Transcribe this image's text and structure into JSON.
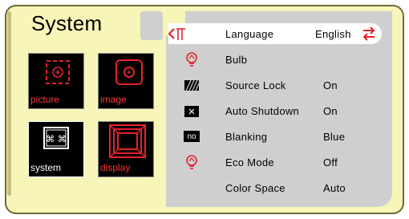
{
  "menu": {
    "title": "System"
  },
  "tiles": [
    {
      "label": "picture",
      "label_color": "#ff3333"
    },
    {
      "label": "image",
      "label_color": "#ff3333"
    },
    {
      "label": "system",
      "label_color": "#ffffff"
    },
    {
      "label": "display",
      "label_color": "#ff3333"
    }
  ],
  "settings": [
    {
      "label": "Language",
      "value": "English",
      "icon": "language-icon",
      "selected": true
    },
    {
      "label": "Bulb",
      "value": "",
      "icon": "bulb-icon"
    },
    {
      "label": "Source Lock",
      "value": "On",
      "icon": "source-lock-icon"
    },
    {
      "label": "Auto Shutdown",
      "value": "On",
      "icon": "auto-shutdown-icon"
    },
    {
      "label": "Blanking",
      "value": "Blue",
      "icon": "blanking-icon",
      "badge": "no"
    },
    {
      "label": "Eco Mode",
      "value": "Off",
      "icon": "eco-mode-bulb-icon"
    },
    {
      "label": "Color Space",
      "value": "Auto",
      "icon": ""
    }
  ],
  "colors": {
    "accent": "#e8202a",
    "panel": "#f7f5b8",
    "menu_bg": "#cfcfcf"
  }
}
